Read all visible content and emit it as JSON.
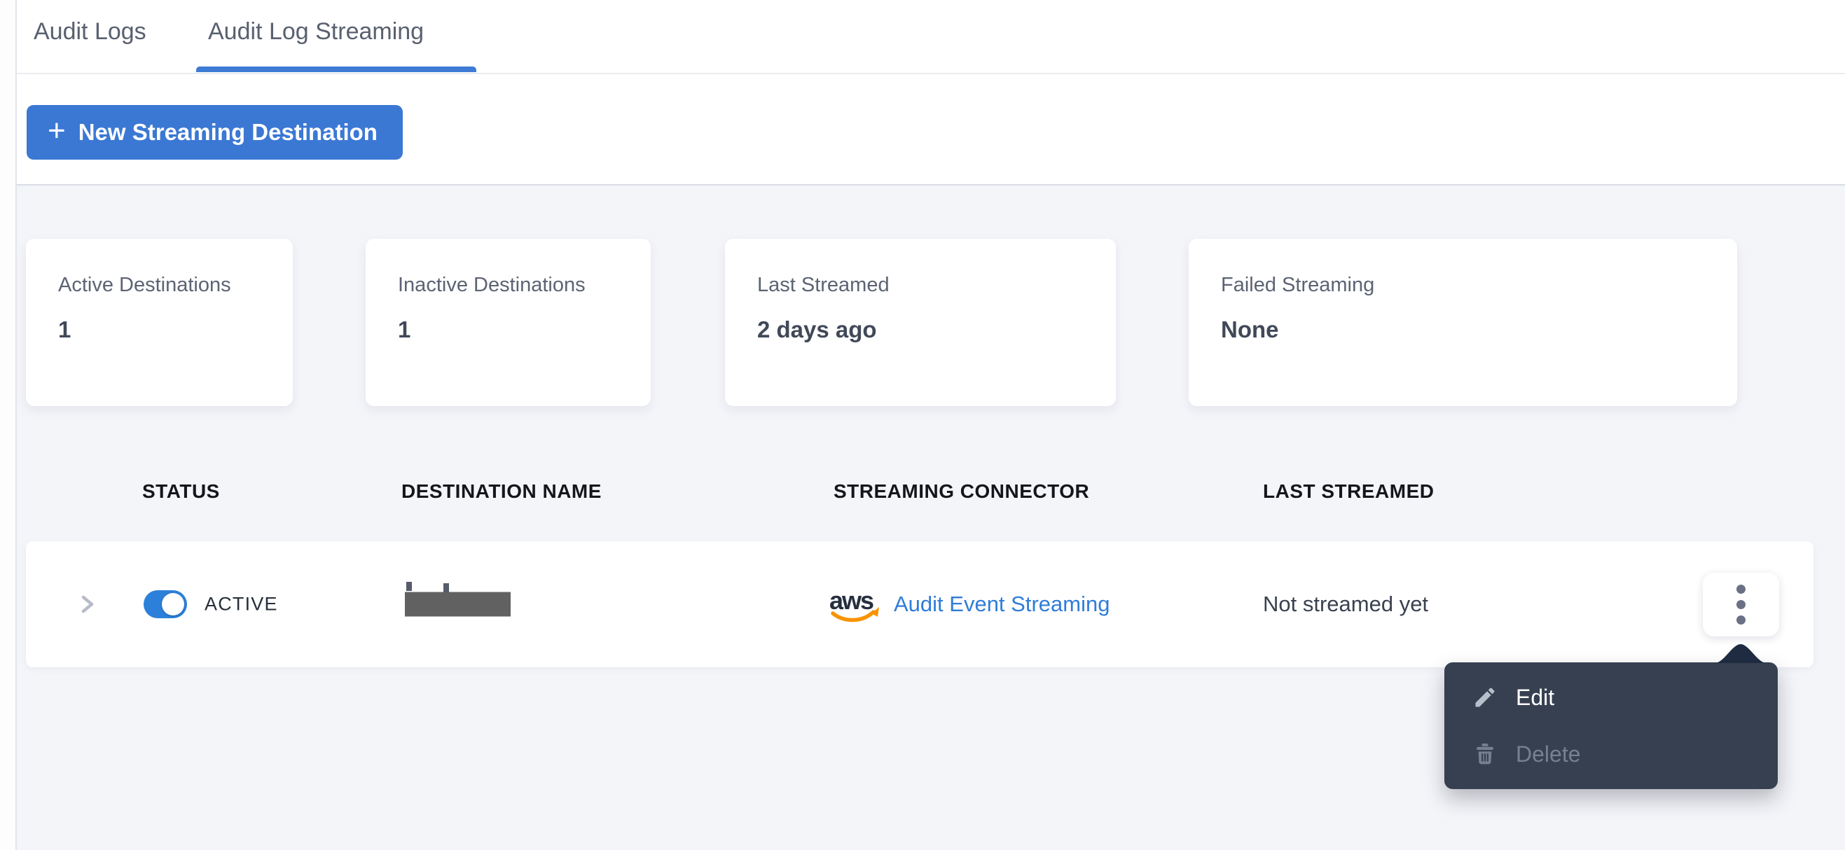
{
  "tabs": [
    {
      "label": "Audit Logs",
      "active": false
    },
    {
      "label": "Audit Log Streaming",
      "active": true
    }
  ],
  "toolbar": {
    "plus_icon": "+",
    "new_destination_label": "New Streaming Destination"
  },
  "summary_cards": [
    {
      "label": "Active Destinations",
      "value": "1"
    },
    {
      "label": "Inactive Destinations",
      "value": "1"
    },
    {
      "label": "Last Streamed",
      "value": "2 days ago"
    },
    {
      "label": "Failed Streaming",
      "value": "None"
    }
  ],
  "table": {
    "columns": [
      "STATUS",
      "DESTINATION NAME",
      "STREAMING CONNECTOR",
      "LAST STREAMED"
    ],
    "rows": [
      {
        "status_label": "ACTIVE",
        "status_on": true,
        "destination_name_redacted": true,
        "connector": {
          "provider": "aws",
          "link_label": "Audit Event Streaming"
        },
        "last_streamed": "Not streamed yet"
      }
    ]
  },
  "context_menu": {
    "items": [
      {
        "label": "Edit",
        "icon": "pencil-icon",
        "enabled": true
      },
      {
        "label": "Delete",
        "icon": "trash-icon",
        "enabled": false
      }
    ]
  },
  "colors": {
    "accent_blue": "#3b78d4",
    "toggle_blue": "#2c80da",
    "link_blue": "#2f7cd9",
    "tab_underline": "#3d7bd5",
    "page_bg": "#f4f5f9",
    "menu_bg": "#364050",
    "menu_caret": "#1e2b41",
    "redaction_gray": "#616161",
    "aws_navy": "#252f3e",
    "aws_orange": "#f79400"
  }
}
